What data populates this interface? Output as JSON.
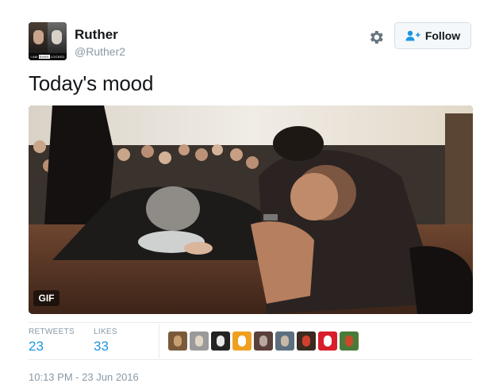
{
  "user": {
    "name": "Ruther",
    "handle": "@Ruther2",
    "avatar_caption_left": "I AM",
    "avatar_caption_box": "SHER",
    "avatar_caption_right": "LOCKED"
  },
  "actions": {
    "follow_label": "Follow",
    "settings_icon": "gear-icon",
    "follow_icon": "add-user-icon"
  },
  "tweet": {
    "text": "Today's mood",
    "media_badge": "GIF"
  },
  "stats": {
    "retweets_label": "RETWEETS",
    "retweets_count": "23",
    "likes_label": "LIKES",
    "likes_count": "33"
  },
  "likers": [
    {
      "colors": [
        "#7a5a3a",
        "#c8a070"
      ]
    },
    {
      "colors": [
        "#9a9a9a",
        "#e0d6c4"
      ]
    },
    {
      "colors": [
        "#222222",
        "#e8e8e8"
      ]
    },
    {
      "colors": [
        "#f0a020",
        "#ffffff"
      ]
    },
    {
      "colors": [
        "#5a3f3a",
        "#b8a8a0"
      ]
    },
    {
      "colors": [
        "#5c6f80",
        "#c8b8a8"
      ]
    },
    {
      "colors": [
        "#3a2a20",
        "#d04030"
      ]
    },
    {
      "colors": [
        "#d81e2c",
        "#ffffff"
      ]
    },
    {
      "colors": [
        "#4a7a3a",
        "#c84a2a"
      ]
    }
  ],
  "meta": {
    "timestamp": "10:13 PM - 23 Jun 2016"
  },
  "theme": {
    "link_blue": "#1b95e0",
    "muted_gray": "#8899a6",
    "text_dark": "#14171a"
  }
}
